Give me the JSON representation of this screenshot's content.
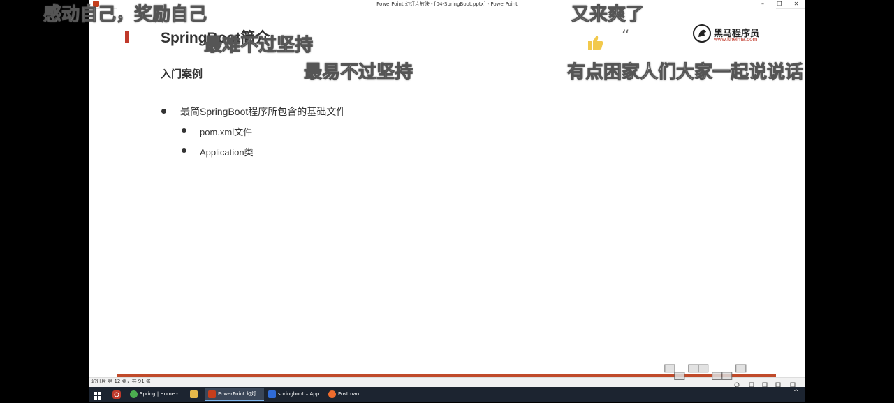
{
  "window": {
    "title": "PowerPoint 幻灯片放映 - [04-SpringBoot.pptx] - PowerPoint",
    "min": "–",
    "max": "❐",
    "close": "✕"
  },
  "slide": {
    "title": "SpringBoot简介",
    "section": "入门案例",
    "bullets": [
      "最简SpringBoot程序所包含的基础文件",
      "pom.xml文件",
      "Application类"
    ],
    "logo": {
      "name": "黑马程序员",
      "url": "www.itheima.com"
    }
  },
  "danmaku": [
    "感动自己，奖励自己",
    "最难不过坚持",
    "最易不过坚持",
    "又来爽了",
    "有点困家人们大家一起说说话"
  ],
  "statusbar": {
    "slide_info": "幻灯片 第 12 张，共 91 张"
  },
  "taskbar": {
    "items": [
      {
        "label": "Spring | Home - ...",
        "icon": "chrome-icon"
      },
      {
        "label": "",
        "icon": "file-explorer-icon"
      },
      {
        "label": "PowerPoint 幻灯...",
        "icon": "powerpoint-icon"
      },
      {
        "label": "springboot – App...",
        "icon": "intellij-icon"
      },
      {
        "label": "Postman",
        "icon": "postman-icon"
      }
    ],
    "tray_arrow": "^"
  },
  "colors": {
    "accent": "#c0392b",
    "taskbar": "#1c2430"
  }
}
